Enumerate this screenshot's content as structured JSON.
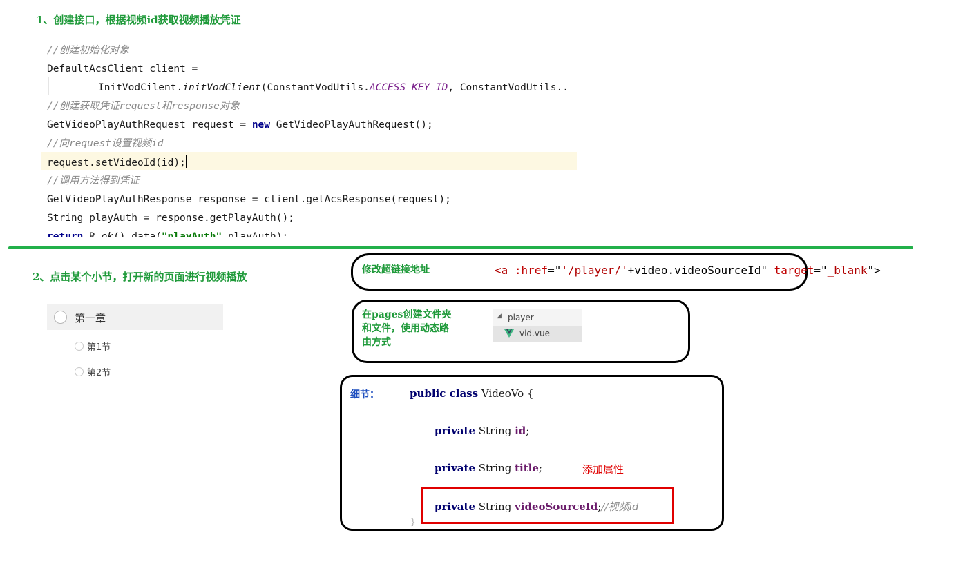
{
  "step1": {
    "heading": "1、创建接口，根据视频id获取视频播放凭证",
    "code": {
      "c1": "//创建初始化对象",
      "l2": "DefaultAcsClient client =",
      "l3_cls": "InitVodCilent.",
      "l3_m": "initVodClient",
      "l3_p": "(ConstantVodUtils.",
      "l3_const": "ACCESS_KEY_ID",
      "l3_tail": ", ConstantVodUtils..",
      "c4": "//创建获取凭证request和response对象",
      "l5_a": "GetVideoPlayAuthRequest request = ",
      "l5_kw": "new",
      "l5_b": " GetVideoPlayAuthRequest();",
      "c6": "//向request设置视频id",
      "l7": "request.setVideoId(id);",
      "c8": "//调用方法得到凭证",
      "l9": "GetVideoPlayAuthResponse response = client.getAcsResponse(request);",
      "l10": "String playAuth = response.getPlayAuth();",
      "l11_kw": "return",
      "l11_a": " R.",
      "l11_m": "ok",
      "l11_b": "().data(",
      "l11_str": "\"playAuth\"",
      "l11_c": ",playAuth);"
    }
  },
  "step2": {
    "heading": "2、点击某个小节，打开新的页面进行视频播放",
    "chapter": "第一章",
    "sections": [
      "第1节",
      "第2节"
    ]
  },
  "note_link": {
    "label": "修改超链接地址",
    "code_open": "<a ",
    "attr_href": ":href",
    "eq1": "=\"",
    "href_str": "'/player/'",
    "href_expr": "+video.videoSourceId",
    "q1": "\"",
    "attr_target": " target",
    "eq2": "=\"",
    "target_val": "_blank",
    "close": "\">"
  },
  "note_pages": {
    "label_line1": "在pages创建文件夹",
    "label_line2": "和文件，使用动态路",
    "label_line3": "由方式",
    "folder": "player",
    "file": "_vid.vue"
  },
  "note_detail": {
    "label": "细节：",
    "class_kw": "public class",
    "class_name": " VideoVo {",
    "field_kw": "private",
    "field_type": " String ",
    "f1": "id",
    "f2": "title",
    "f3": "videoSourceId",
    "semi": ";",
    "comment": "//视频id",
    "add_note": "添加属性",
    "close_brace": "}"
  },
  "colors": {
    "heading_green": "#1f9a3a",
    "divider_green": "#22b04a",
    "highlight_red": "#e00000",
    "line_highlight": "#fdf8e2"
  }
}
